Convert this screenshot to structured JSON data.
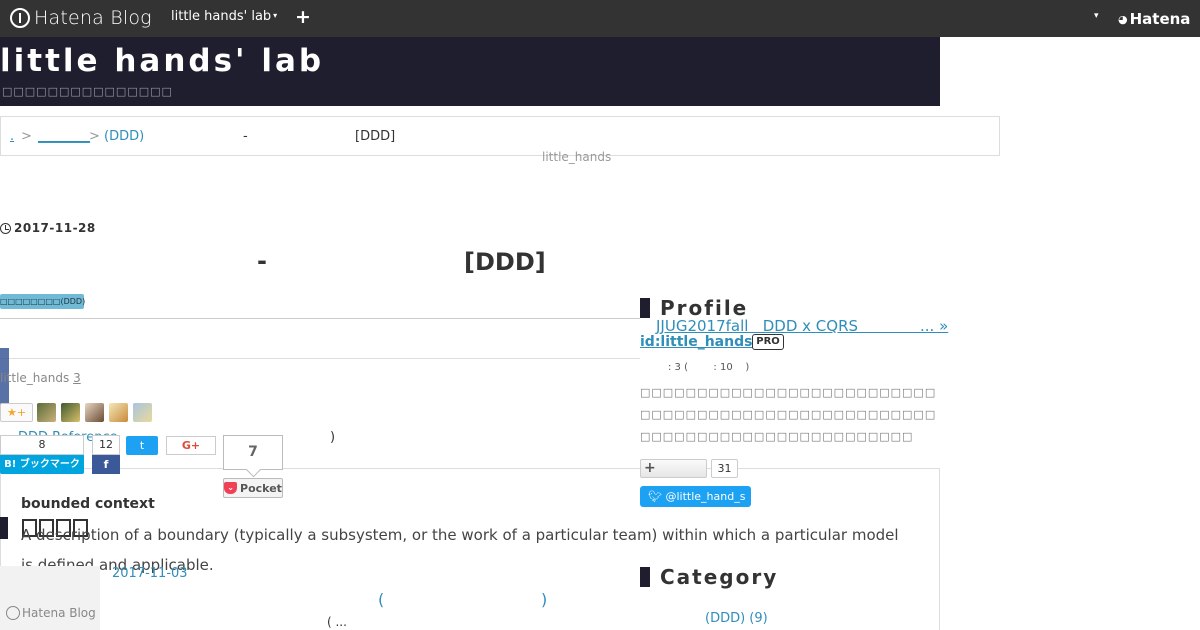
{
  "topbar": {
    "logo_text": "Hatena Blog",
    "blog_name": "little hands' lab",
    "blog_caret": "▾",
    "add": "+",
    "dropdown": "▾",
    "hatena": "Hatena"
  },
  "header": {
    "title": "little hands' lab",
    "description": "□□□□□□□□□□□□□□□"
  },
  "breadcrumb": {
    "items": [
      ".",
      "________",
      "(DDD)"
    ],
    "separator": ">",
    "dash": "-",
    "tag": "[DDD]"
  },
  "author": {
    "name": "little_hands"
  },
  "post": {
    "date": "2017-11-28",
    "title_left": "-",
    "title_right": "[DDD]",
    "category": "□□□□□□□□(DDD)",
    "author_line_name": "little_hands",
    "author_line_count": "3",
    "star_add": "★+",
    "ddd_ref": "DDD Reference",
    "paren_right": ")"
  },
  "share": {
    "hatebu_count": "8",
    "hatebu_label": "B! ブックマーク",
    "facebook_count": "12",
    "facebook_label": "f",
    "twitter_label": "t",
    "gplus_label": "G+",
    "pocket_count": "7",
    "pocket_label": "Pocket"
  },
  "embed": {
    "title": "bounded context",
    "text": "A description of a boundary (typically a subsystem, or the work of a particular team) within which a particular model is defined and applicable."
  },
  "related": {
    "logo_text": "Hatena Blog",
    "date": "2017-11-03",
    "paren_open": "(",
    "paren_close": ")",
    "ellipsis": "(    ..."
  },
  "sidebar": {
    "profile_heading": "Profile",
    "jjug_link": "JJUG2017fall   DDD x CQRS             ... »",
    "profile_id": "id:little_hands",
    "pro_badge": "PRO",
    "stats": ": 3 (        : 10    )",
    "profile_desc": "□□□□□□□□□□□□□□□□□□□□□□□□□□□□□□□□□□□□□□□□□□□□□□□□□□□□□□□□□□□□□□□□□□□□□□□□□□□□",
    "follow_label": "+",
    "follow_count": "31",
    "twitter_handle": "@little_hand_s",
    "category_heading": "Category",
    "category_item": "(DDD) (9)"
  },
  "colors": {
    "topbar": "#333333",
    "header_bg": "#1e1e2e",
    "link": "#2f8eba",
    "hatebu": "#00a4de",
    "facebook": "#3b5998",
    "twitter": "#1da1f2",
    "pocket": "#ef4056"
  }
}
